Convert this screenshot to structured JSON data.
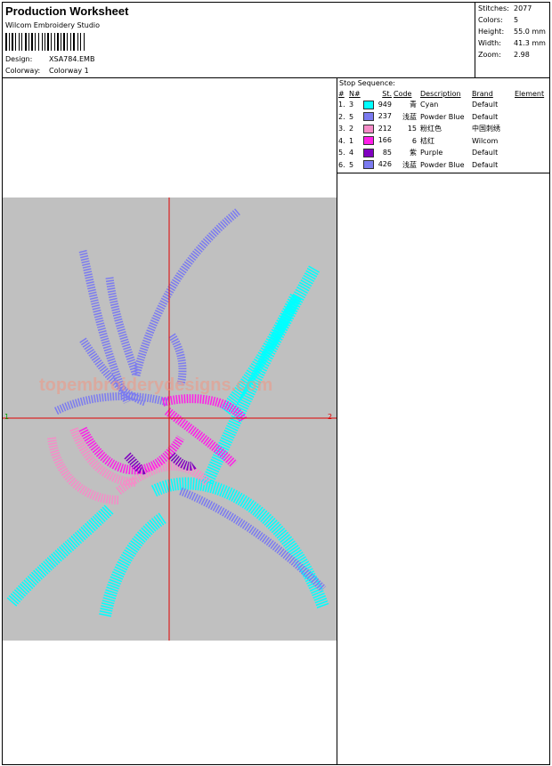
{
  "header": {
    "title": "Production Worksheet",
    "software": "Wilcom Embroidery Studio",
    "design_label": "Design:",
    "design_value": "XSA784.EMB",
    "colorway_label": "Colorway:",
    "colorway_value": "Colorway 1"
  },
  "stats": [
    {
      "label": "Stitches:",
      "value": "2077"
    },
    {
      "label": "Colors:",
      "value": "5"
    },
    {
      "label": "Height:",
      "value": "55.0 mm"
    },
    {
      "label": "Width:",
      "value": "41.3 mm"
    },
    {
      "label": "Zoom:",
      "value": "2.98"
    }
  ],
  "stop_sequence": {
    "title": "Stop Sequence:",
    "columns": [
      "#",
      "N#",
      "St.",
      "Code",
      "Description",
      "Brand",
      "Element"
    ],
    "rows": [
      {
        "num": "1.",
        "n": "3",
        "color": "#00ffff",
        "st": "949",
        "code": "青",
        "desc": "Cyan",
        "brand": "Default"
      },
      {
        "num": "2.",
        "n": "5",
        "color": "#7b7bf0",
        "st": "237",
        "code": "浅蓝",
        "desc": "Powder Blue",
        "brand": "Default"
      },
      {
        "num": "3.",
        "n": "2",
        "color": "#f58cc8",
        "st": "212",
        "code": "15",
        "desc": "粉红色",
        "brand": "中国刺绣"
      },
      {
        "num": "4.",
        "n": "1",
        "color": "#ff1ee8",
        "st": "166",
        "code": "6",
        "desc": "桔红",
        "brand": "Wilcom"
      },
      {
        "num": "5.",
        "n": "4",
        "color": "#8000c0",
        "st": "85",
        "code": "紫",
        "desc": "Purple",
        "brand": "Default"
      },
      {
        "num": "6.",
        "n": "5",
        "color": "#7b7bf0",
        "st": "426",
        "code": "浅蓝",
        "desc": "Powder Blue",
        "brand": "Default"
      }
    ]
  },
  "preview": {
    "background": "#c0c0c0",
    "axis_color": "#e00000",
    "axis_label_left": "1",
    "axis_label_right": "2",
    "watermark": "topembroiderydesigns.com"
  }
}
